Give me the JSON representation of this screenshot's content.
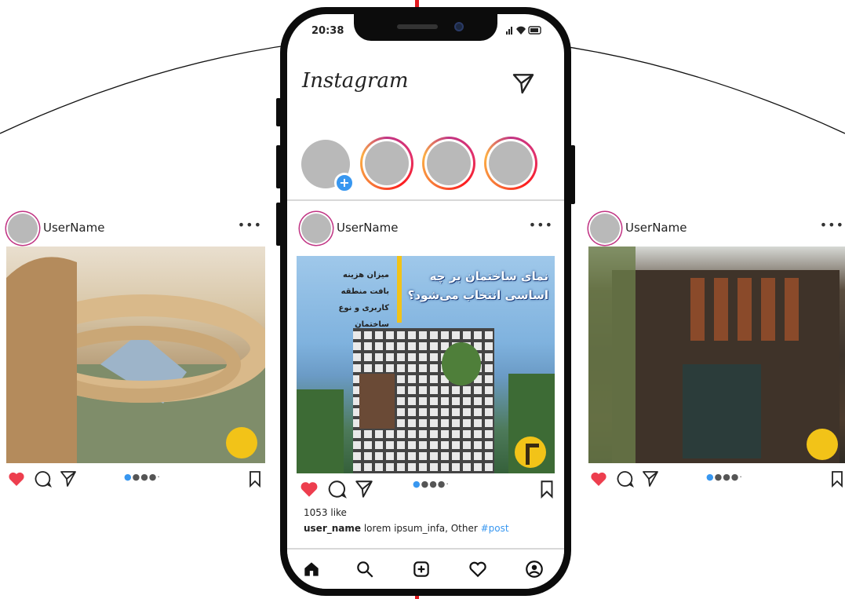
{
  "colors": {
    "brand_gradient": [
      "#c13584",
      "#e1306c",
      "#fd1d1d",
      "#f77737",
      "#fcaf45"
    ],
    "like_red": "#ed3e4e",
    "link_blue": "#3897f0",
    "accent_red": "#e0191f",
    "logo_yellow": "#f2c318"
  },
  "status_bar": {
    "time": "20:38",
    "icons": "signal wifi battery"
  },
  "app": {
    "title": "Instagram",
    "direct_icon": "paper-plane-icon"
  },
  "stories": [
    {
      "type": "own",
      "icon": "plus-icon"
    },
    {
      "type": "story"
    },
    {
      "type": "story"
    },
    {
      "type": "story"
    }
  ],
  "main_post": {
    "username": "UserName",
    "more": "•••",
    "image_text": {
      "headline": "نمای ساختمان بر چه اساسی انتخاب می‌شود؟",
      "items": [
        "میزان هزینه",
        "بافت منطقه",
        "کاربری و نوع ساختمان"
      ]
    },
    "carousel": {
      "count": 5,
      "active": 1
    },
    "likes": "1053 like",
    "caption_user": "user_name",
    "caption_text": " lorem ipsum_infa, Other ",
    "caption_tag": "#post"
  },
  "side_posts": [
    {
      "username": "UserName",
      "more": "•••",
      "carousel": {
        "count": 5,
        "active": 1
      }
    },
    {
      "username": "UserName",
      "more": "•••",
      "carousel": {
        "count": 5,
        "active": 1
      }
    }
  ],
  "bottom_nav": [
    "home-icon",
    "search-icon",
    "add-post-icon",
    "activity-heart-icon",
    "profile-icon"
  ]
}
